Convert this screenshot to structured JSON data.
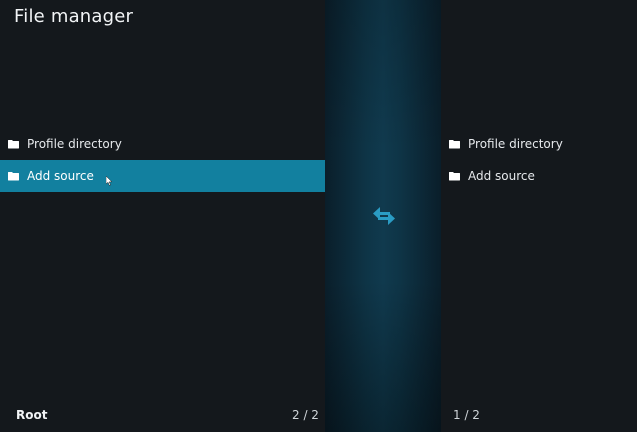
{
  "header": {
    "title": "File manager"
  },
  "left_pane": {
    "items": [
      {
        "label": "Profile directory",
        "icon": "folder-icon"
      },
      {
        "label": "Add source",
        "icon": "folder-icon"
      }
    ],
    "focused_index": 1,
    "path_label": "Root",
    "page_indicator": "2 / 2"
  },
  "right_pane": {
    "items": [
      {
        "label": "Profile directory",
        "icon": "folder-icon"
      },
      {
        "label": "Add source",
        "icon": "folder-icon"
      }
    ],
    "page_indicator": "1 / 2"
  },
  "center": {
    "icon": "swap-arrows-icon"
  },
  "colors": {
    "accent": "#12809f",
    "swap_icon": "#2a9cc4",
    "background": "#14181c"
  }
}
